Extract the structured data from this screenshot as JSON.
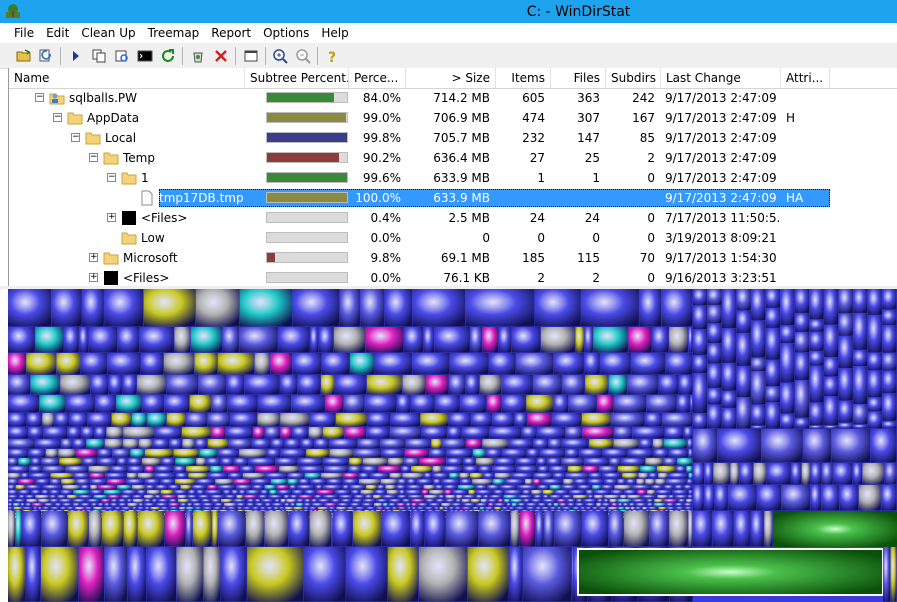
{
  "window": {
    "title": "C: - WinDirStat"
  },
  "menu": [
    "File",
    "Edit",
    "Clean Up",
    "Treemap",
    "Report",
    "Options",
    "Help"
  ],
  "toolbar": [
    {
      "icon": "open-folder-icon"
    },
    {
      "icon": "refresh-icon"
    },
    {
      "icon": "expand-icon"
    },
    {
      "icon": "copy-path-icon"
    },
    {
      "icon": "explorer-icon"
    },
    {
      "icon": "command-prompt-icon"
    },
    {
      "icon": "refresh-selected-icon"
    },
    {
      "icon": "recycle-bin-icon"
    },
    {
      "icon": "delete-icon"
    },
    {
      "icon": "properties-icon"
    },
    {
      "icon": "zoom-in-icon"
    },
    {
      "icon": "zoom-out-icon"
    },
    {
      "icon": "help-icon"
    }
  ],
  "columns": [
    "Name",
    "Subtree Percent...",
    "Perce...",
    "> Size",
    "Items",
    "Files",
    "Subdirs",
    "Last Change",
    "Attri..."
  ],
  "rows": [
    {
      "name": "sqlballs.PW",
      "icon": "user-folder-icon",
      "expander": "−",
      "bar": 0.84,
      "bar_color": "#3a8a3a",
      "percent": "84.0%",
      "size": "714.2 MB",
      "items": "605",
      "files": "363",
      "subdirs": "242",
      "last_change": "9/17/2013  2:47:09 ...",
      "attr": ""
    },
    {
      "name": "AppData",
      "icon": "folder-icon",
      "expander": "−",
      "bar": 0.99,
      "bar_color": "#8a8a40",
      "percent": "99.0%",
      "size": "706.9 MB",
      "items": "474",
      "files": "307",
      "subdirs": "167",
      "last_change": "9/17/2013  2:47:09 ...",
      "attr": "H"
    },
    {
      "name": "Local",
      "icon": "folder-icon",
      "expander": "−",
      "bar": 0.998,
      "bar_color": "#3c3c8c",
      "percent": "99.8%",
      "size": "705.7 MB",
      "items": "232",
      "files": "147",
      "subdirs": "85",
      "last_change": "9/17/2013  2:47:09 ...",
      "attr": ""
    },
    {
      "name": "Temp",
      "icon": "folder-icon",
      "expander": "−",
      "bar": 0.902,
      "bar_color": "#8c3c3c",
      "percent": "90.2%",
      "size": "636.4 MB",
      "items": "27",
      "files": "25",
      "subdirs": "2",
      "last_change": "9/17/2013  2:47:09 ...",
      "attr": ""
    },
    {
      "name": "1",
      "icon": "folder-icon",
      "expander": "−",
      "bar": 0.996,
      "bar_color": "#3a8a3a",
      "percent": "99.6%",
      "size": "633.9 MB",
      "items": "1",
      "files": "1",
      "subdirs": "0",
      "last_change": "9/17/2013  2:47:09 ...",
      "attr": ""
    },
    {
      "name": "tmp17DB.tmp",
      "icon": "file-icon",
      "expander": "",
      "bar": 1.0,
      "bar_color": "#8a8a40",
      "percent": "100.0%",
      "size": "633.9 MB",
      "items": "",
      "files": "",
      "subdirs": "",
      "last_change": "9/17/2013  2:47:09 ...",
      "attr": "HA"
    },
    {
      "name": "<Files>",
      "icon": "files-icon",
      "expander": "+",
      "bar": 0.004,
      "bar_color": "#888888",
      "percent": "0.4%",
      "size": "2.5 MB",
      "items": "24",
      "files": "24",
      "subdirs": "0",
      "last_change": "7/17/2013  11:50:5...",
      "attr": ""
    },
    {
      "name": "Low",
      "icon": "folder-icon",
      "expander": "",
      "bar": 0.0,
      "bar_color": "#888888",
      "percent": "0.0%",
      "size": "0",
      "items": "0",
      "files": "0",
      "subdirs": "0",
      "last_change": "3/19/2013  8:09:21 ...",
      "attr": ""
    },
    {
      "name": "Microsoft",
      "icon": "folder-icon",
      "expander": "+",
      "bar": 0.098,
      "bar_color": "#8c3c3c",
      "percent": "9.8%",
      "size": "69.1 MB",
      "items": "185",
      "files": "115",
      "subdirs": "70",
      "last_change": "9/17/2013  1:54:30 ...",
      "attr": ""
    },
    {
      "name": "<Files>",
      "icon": "files-icon",
      "expander": "+",
      "bar": 0.0,
      "bar_color": "#888888",
      "percent": "0.0%",
      "size": "76.1 KB",
      "items": "2",
      "files": "2",
      "subdirs": "0",
      "last_change": "9/16/2013  3:23:51 ...",
      "attr": ""
    }
  ],
  "colors": {
    "titlebar": "#1ea4ee",
    "selection": "#3399ff",
    "treemap_base": "#4a4ae8",
    "treemap_highlight": "#ffffff",
    "large_file": "#2f9a2f"
  }
}
